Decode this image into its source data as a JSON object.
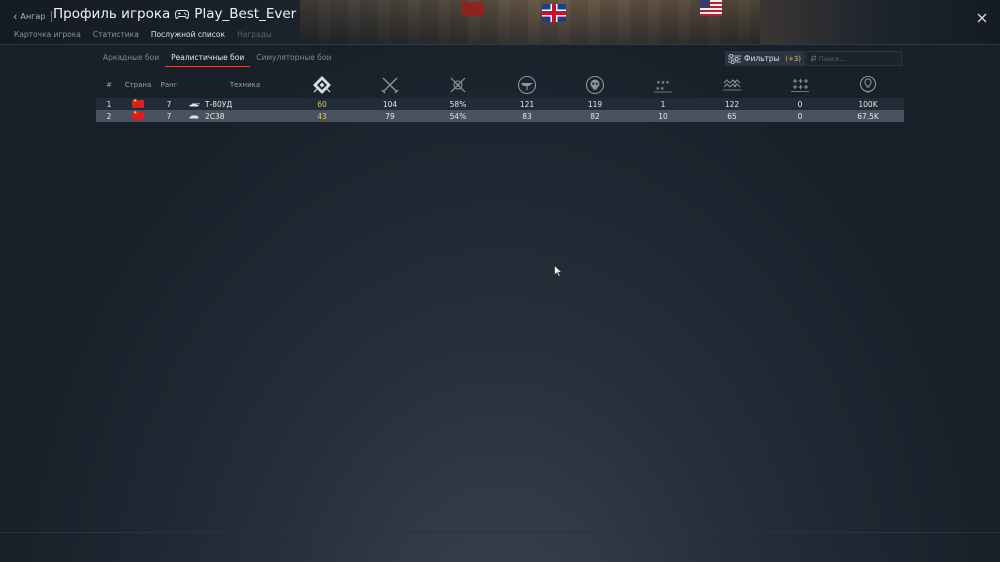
{
  "header": {
    "back_label": "Ангар",
    "title": "Профиль игрока",
    "player_name": "Play_Best_Ever"
  },
  "subtabs": [
    {
      "label": "Карточка игрока",
      "state": "normal"
    },
    {
      "label": "Статистика",
      "state": "normal"
    },
    {
      "label": "Послужной список",
      "state": "active"
    },
    {
      "label": "Награды",
      "state": "dim"
    }
  ],
  "mode_tabs": [
    {
      "label": "Аркадные бои",
      "active": false
    },
    {
      "label": "Реалистичные бои",
      "active": true
    },
    {
      "label": "Симуляторные бои",
      "active": false
    }
  ],
  "filters": {
    "label": "Фильтры",
    "count": "(+3)"
  },
  "search": {
    "placeholder": "Поиск..."
  },
  "table": {
    "headers": {
      "num": "#",
      "country": "Страна",
      "rank": "Ранг",
      "vehicle": "Техника"
    },
    "stat_icons": [
      "battles-icon",
      "victories-icon",
      "winrate-icon",
      "air-kills-icon",
      "ground-kills-icon",
      "naval-kills-icon",
      "respawns-icon",
      "deaths-icon",
      "research-points-icon"
    ],
    "rows": [
      {
        "num": "1",
        "country": "china-flag-icon",
        "rank": "7",
        "vehicle": "Т-80УД",
        "stats": [
          "60",
          "104",
          "58%",
          "121",
          "119",
          "1",
          "122",
          "0",
          "100K"
        ]
      },
      {
        "num": "2",
        "country": "china-flag-icon",
        "rank": "7",
        "vehicle": "2С38",
        "stats": [
          "43",
          "79",
          "54%",
          "83",
          "82",
          "10",
          "65",
          "0",
          "67.5K"
        ]
      }
    ]
  },
  "colors": {
    "accent_red": "#d24a3c",
    "highlight_yellow": "#e5c35c",
    "row_selected": "#4a5260",
    "background": "#18202a"
  }
}
